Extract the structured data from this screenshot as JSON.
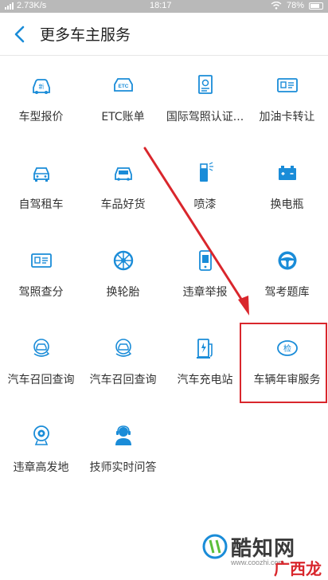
{
  "status_bar": {
    "network_speed": "2.73K/s",
    "time": "18:17",
    "battery": "78%"
  },
  "header": {
    "title": "更多车主服务",
    "back_icon": "chevron-left-icon"
  },
  "accent_color": "#1a8cd8",
  "highlight_color": "#d9262c",
  "services": [
    {
      "label": "车型报价",
      "icon": "car-new-icon"
    },
    {
      "label": "ETC账单",
      "icon": "etc-icon"
    },
    {
      "label": "国际驾照认证...",
      "icon": "license-doc-icon"
    },
    {
      "label": "加油卡转让",
      "icon": "id-card-icon"
    },
    {
      "label": "自驾租车",
      "icon": "car-front-icon"
    },
    {
      "label": "车品好货",
      "icon": "car-goods-icon"
    },
    {
      "label": "喷漆",
      "icon": "spray-icon"
    },
    {
      "label": "换电瓶",
      "icon": "battery-icon"
    },
    {
      "label": "驾照查分",
      "icon": "id-card-icon"
    },
    {
      "label": "换轮胎",
      "icon": "tire-icon"
    },
    {
      "label": "违章举报",
      "icon": "phone-report-icon"
    },
    {
      "label": "驾考题库",
      "icon": "steering-wheel-icon"
    },
    {
      "label": "汽车召回查询",
      "icon": "recall-icon"
    },
    {
      "label": "汽车召回查询",
      "icon": "recall-icon"
    },
    {
      "label": "汽车充电站",
      "icon": "charging-icon"
    },
    {
      "label": "车辆年审服务",
      "icon": "inspection-icon"
    },
    {
      "label": "违章高发地",
      "icon": "camera-icon"
    },
    {
      "label": "技师实时问答",
      "icon": "technician-icon"
    }
  ],
  "watermark": {
    "title": "酷知网",
    "url": "www.coozhi.com",
    "sub": "广西龙网"
  }
}
